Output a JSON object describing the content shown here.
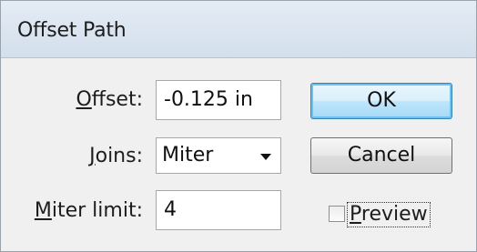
{
  "dialog": {
    "title": "Offset Path"
  },
  "offset": {
    "label_mnemonic": "O",
    "label_rest": "ffset:",
    "value": "-0.125 in"
  },
  "joins": {
    "label_mnemonic": "J",
    "label_rest": "oins:",
    "value": "Miter"
  },
  "miter_limit": {
    "label_mnemonic": "M",
    "label_rest": "iter limit:",
    "value": "4"
  },
  "buttons": {
    "ok": "OK",
    "cancel": "Cancel"
  },
  "preview": {
    "label_mnemonic": "P",
    "label_rest": "review",
    "checked": false
  }
}
